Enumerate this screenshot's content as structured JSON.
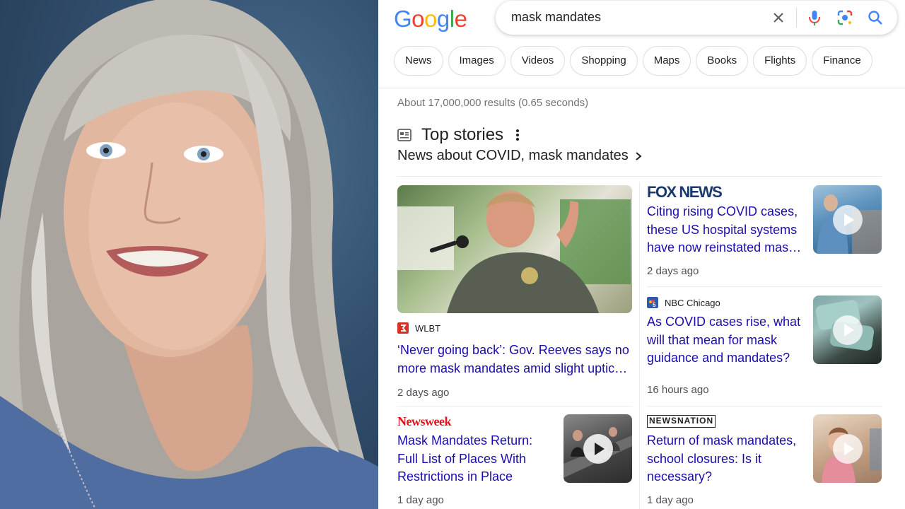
{
  "search": {
    "query": "mask mandates",
    "clear_icon": "close-icon",
    "voice_icon": "mic-icon",
    "lens_icon": "lens-icon",
    "search_icon": "search-icon"
  },
  "logo": {
    "letters": [
      "G",
      "o",
      "o",
      "g",
      "l",
      "e"
    ],
    "colors": [
      "#4285f4",
      "#ea4335",
      "#fbbc05",
      "#4285f4",
      "#34a853",
      "#ea4335"
    ]
  },
  "tabs": [
    "News",
    "Images",
    "Videos",
    "Shopping",
    "Maps",
    "Books",
    "Flights",
    "Finance"
  ],
  "stats": "About 17,000,000 results (0.65 seconds)",
  "top_stories": {
    "title": "Top stories",
    "subtitle": "News about COVID, mask mandates",
    "colors": {
      "link": "#1a0dab",
      "meta": "#4d5156",
      "fox": "#1a3a6e",
      "newsweek": "#e4121d"
    },
    "stories": [
      {
        "source": "WLBT",
        "headline": "‘Never going back’: Gov. Reeves says no more mask mandates amid slight uptick in ...",
        "age": "2 days ago"
      },
      {
        "source": "FOX NEWS",
        "headline": "Citing rising COVID cases, these US hospital systems have now reinstated mask ...",
        "age": "2 days ago"
      },
      {
        "source": "NBC Chicago",
        "headline": "As COVID cases rise, what will that mean for mask guidance and mandates?",
        "age": "16 hours ago"
      },
      {
        "source": "Newsweek",
        "headline": "Mask Mandates Return: Full List of Places With Restrictions in Place",
        "age": "1 day ago"
      },
      {
        "source": "NEWSNATION",
        "headline": "Return of mask mandates, school closures: Is it necessary?",
        "age": "1 day ago"
      }
    ]
  }
}
